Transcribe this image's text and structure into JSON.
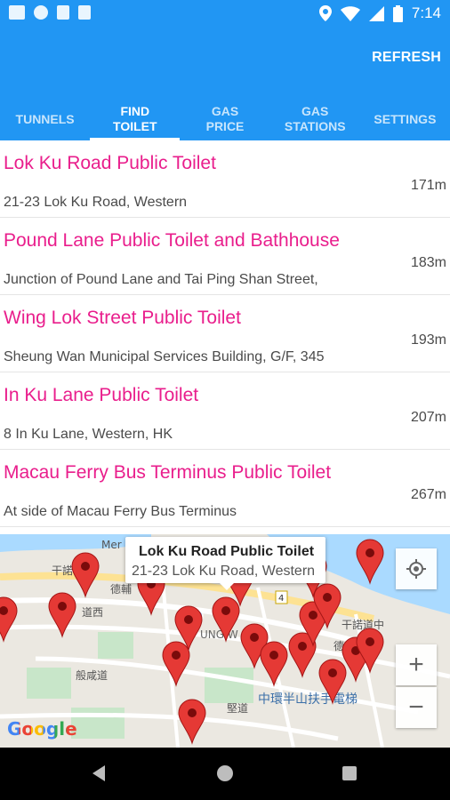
{
  "status_bar": {
    "time": "7:14"
  },
  "app_bar": {
    "refresh_label": "REFRESH"
  },
  "tabs": [
    {
      "label": "TUNNELS"
    },
    {
      "label": "FIND\nTOILET"
    },
    {
      "label": "GAS\nPRICE"
    },
    {
      "label": "GAS\nSTATIONS"
    },
    {
      "label": "SETTINGS"
    }
  ],
  "toilets": [
    {
      "name": "Lok Ku Road Public Toilet",
      "address": "21-23 Lok Ku Road, Western",
      "distance": "171m"
    },
    {
      "name": "Pound Lane Public Toilet and Bathhouse",
      "address": "Junction of Pound Lane and Tai Ping Shan Street,",
      "distance": "183m"
    },
    {
      "name": "Wing Lok Street Public Toilet",
      "address": "Sheung Wan Municipal Services Building, G/F, 345",
      "distance": "193m"
    },
    {
      "name": "In Ku Lane Public Toilet",
      "address": "8 In Ku Lane, Western, HK",
      "distance": "207m"
    },
    {
      "name": "Macau Ferry Bus Terminus Public Toilet",
      "address": "At side of Macau Ferry Bus Terminus",
      "distance": "267m"
    }
  ],
  "map": {
    "info_title": "Lok Ku Road Public Toilet",
    "info_subtitle": "21-23 Lok Ku Road, Western",
    "labels": {
      "road_a": "干諾",
      "road_b": "德輔",
      "road_c": "道西",
      "road_d": "般咸道",
      "road_e": "堅道",
      "road_f": "干諾道中",
      "road_g": "德輔道中",
      "district": "UNG W",
      "mid_levels": "中環半山扶手電梯",
      "mer": "Mer",
      "route_no": "4"
    },
    "zoom_in": "+",
    "zoom_out": "−",
    "google": "Google",
    "colors": {
      "water": "#aadaff",
      "land": "#ebe8e1",
      "marker": "#e53935",
      "road": "#ffffff",
      "road_major": "#fde293",
      "park": "#c8e6c9"
    }
  },
  "icons": {
    "wifi": "wifi-icon",
    "signal": "signal-icon",
    "battery": "battery-icon",
    "location": "location-icon",
    "locate": "my-location-icon"
  }
}
